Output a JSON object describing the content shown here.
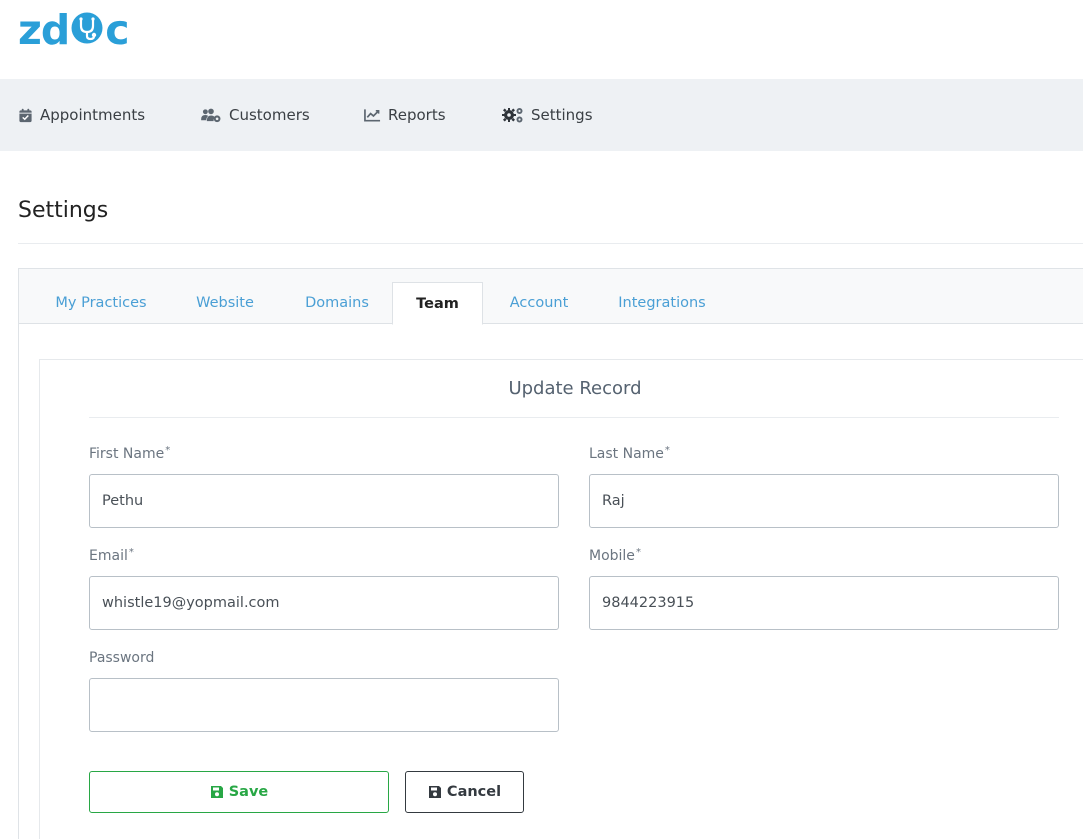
{
  "brand": {
    "logo_left": "zd",
    "logo_right": "c",
    "color": "#2a9fd8"
  },
  "nav": {
    "items": [
      {
        "label": "Appointments",
        "icon": "calendar-check-icon"
      },
      {
        "label": "Customers",
        "icon": "users-cog-icon"
      },
      {
        "label": "Reports",
        "icon": "line-chart-icon"
      },
      {
        "label": "Settings",
        "icon": "cogs-icon"
      }
    ]
  },
  "page": {
    "title": "Settings"
  },
  "tabs": [
    {
      "label": "My Practices"
    },
    {
      "label": "Website"
    },
    {
      "label": "Domains"
    },
    {
      "label": "Team",
      "active": true
    },
    {
      "label": "Account"
    },
    {
      "label": "Integrations"
    }
  ],
  "form": {
    "title": "Update Record",
    "required_mark": "*",
    "first_name": {
      "label": "First Name",
      "value": "Pethu"
    },
    "last_name": {
      "label": "Last Name",
      "value": "Raj"
    },
    "email": {
      "label": "Email",
      "value": "whistle19@yopmail.com"
    },
    "mobile": {
      "label": "Mobile",
      "value": "9844223915"
    },
    "password": {
      "label": "Password",
      "value": ""
    },
    "save_label": "Save",
    "cancel_label": "Cancel"
  },
  "colors": {
    "accent": "#2a9fd8",
    "save": "#28a745",
    "cancel": "#343a40",
    "tab_link": "#4a9fd5"
  }
}
